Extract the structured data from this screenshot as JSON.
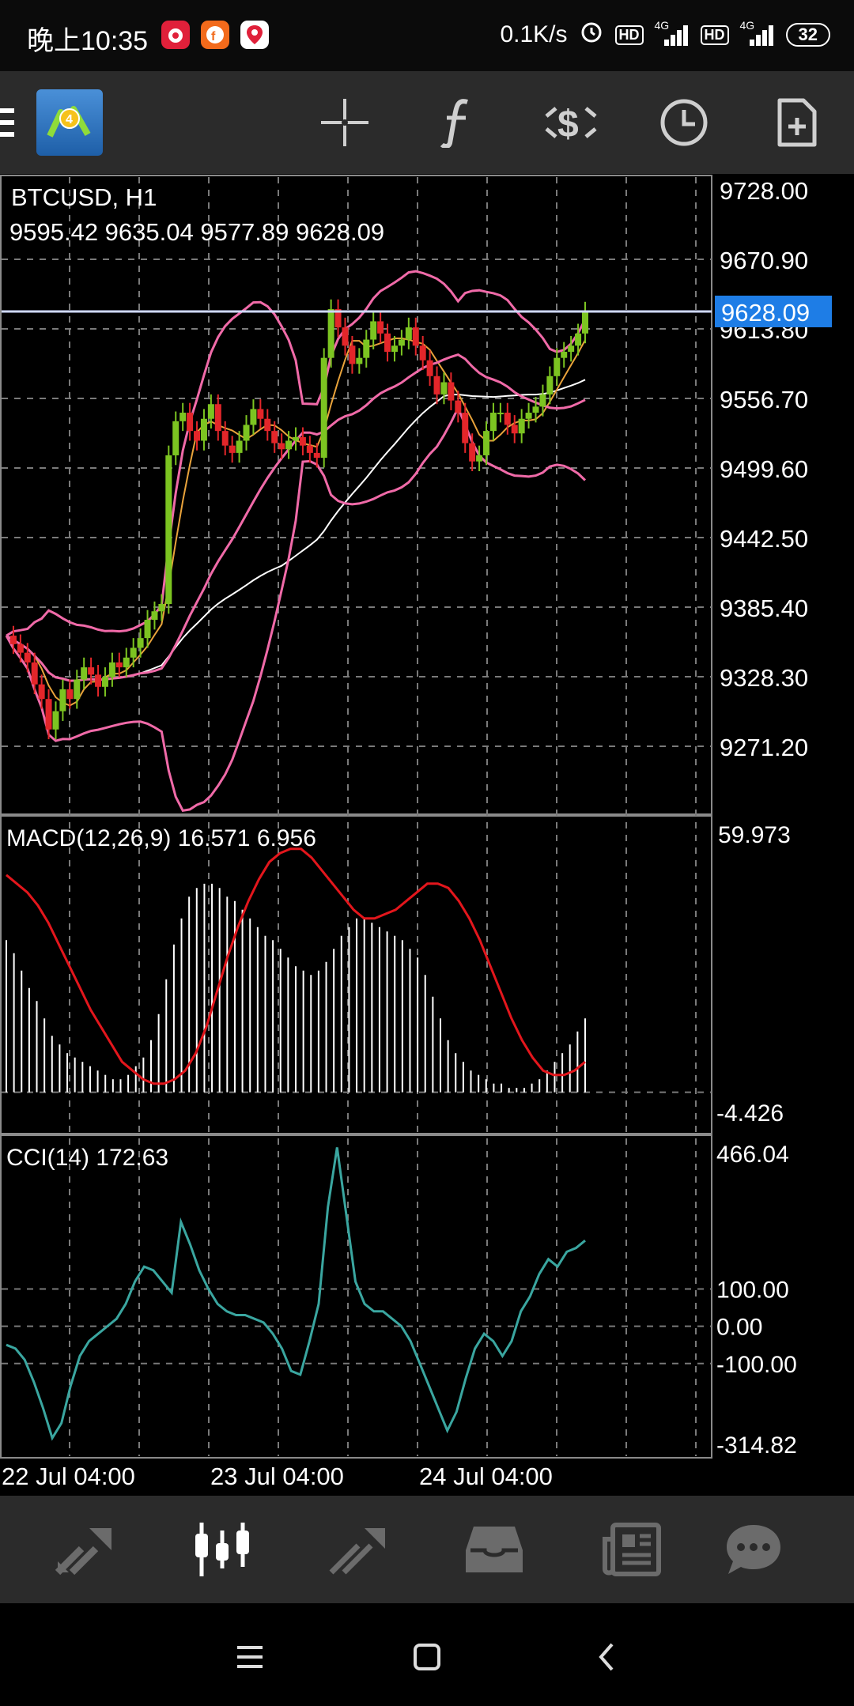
{
  "status_bar": {
    "time": "晚上10:35",
    "net_speed": "0.1K/s",
    "hd1": "HD",
    "net1": "4G",
    "hd2": "HD",
    "net2": "4G",
    "battery": "32",
    "app_icons": [
      "weibo-icon",
      "f-app-icon",
      "map-pin-app-icon"
    ]
  },
  "toolbar": {
    "icons": [
      "menu-icon",
      "metatrader4-logo",
      "crosshair-icon",
      "indicators-icon",
      "trade-icon",
      "timeframe-clock-icon",
      "new-order-icon"
    ]
  },
  "chart": {
    "symbol_label": "BTCUSD, H1",
    "ohlc_label": "9595.42 9635.04 9577.89 9628.09",
    "current_price": "9628.09",
    "price_axis": [
      "9728.00",
      "9670.90",
      "9613.80",
      "9556.70",
      "9499.60",
      "9442.50",
      "9385.40",
      "9328.30",
      "9271.20"
    ],
    "macd_label": "MACD(12,26,9) 16.571 6.956",
    "macd_axis": [
      "59.973",
      "-4.426"
    ],
    "cci_label": "CCI(14) 172.63",
    "cci_axis": [
      "466.04",
      "100.00",
      "0.00",
      "-100.00",
      "-314.82"
    ],
    "time_axis": [
      "22 Jul 04:00",
      "23 Jul 04:00",
      "24 Jul 04:00"
    ],
    "colors": {
      "bull": "#7cc421",
      "bear": "#e3262a",
      "bands": "#f06aa8",
      "ma_fast": "#e9a33b",
      "ma_slow": "#ffffff",
      "macd_signal": "#e3161c",
      "cci": "#3aa6a0",
      "bid_line": "#cfd9ff",
      "price_tag": "#1e7de6"
    }
  },
  "chart_data": {
    "type": "line",
    "title": "BTCUSD, H1",
    "last_ohlc": {
      "open": 9595.42,
      "high": 9635.04,
      "low": 9577.89,
      "close": 9628.09
    },
    "ylim": [
      9242.65,
      9728.0
    ],
    "x_ticks": [
      "22 Jul 04:00",
      "23 Jul 04:00",
      "24 Jul 04:00"
    ],
    "close": [
      9362,
      9355,
      9348,
      9340,
      9322,
      9310,
      9285,
      9300,
      9318,
      9310,
      9326,
      9336,
      9330,
      9320,
      9328,
      9340,
      9336,
      9344,
      9352,
      9360,
      9375,
      9382,
      9388,
      9510,
      9538,
      9545,
      9530,
      9522,
      9540,
      9552,
      9530,
      9518,
      9512,
      9522,
      9535,
      9548,
      9540,
      9530,
      9520,
      9515,
      9522,
      9525,
      9518,
      9512,
      9508,
      9590,
      9630,
      9615,
      9600,
      9585,
      9590,
      9605,
      9620,
      9610,
      9595,
      9600,
      9605,
      9615,
      9600,
      9588,
      9575,
      9560,
      9570,
      9555,
      9545,
      9520,
      9505,
      9510,
      9530,
      9545,
      9545,
      9535,
      9528,
      9540,
      9545,
      9550,
      9560,
      9575,
      9590,
      9595,
      9600,
      9610,
      9628
    ],
    "macd_histogram": [
      35,
      32,
      28,
      24,
      21,
      17,
      13,
      11,
      9,
      8,
      7,
      6,
      5,
      4,
      3,
      3,
      4,
      6,
      8,
      12,
      18,
      26,
      34,
      40,
      45,
      47,
      48,
      48,
      47,
      45,
      44,
      42,
      40,
      38,
      36,
      35,
      33,
      31,
      29,
      28,
      27,
      28,
      30,
      33,
      36,
      38,
      40,
      40,
      39,
      38,
      37,
      36,
      35,
      33,
      31,
      27,
      22,
      17,
      12,
      9,
      7,
      5,
      4,
      3,
      2,
      2,
      1,
      1,
      1,
      2,
      3,
      5,
      7,
      9,
      11,
      14,
      17
    ],
    "macd_signal": [
      50,
      48,
      46,
      43,
      39,
      34,
      29,
      24,
      19,
      15,
      11,
      7,
      5,
      3,
      2,
      2,
      3,
      5,
      9,
      15,
      23,
      31,
      38,
      44,
      49,
      53,
      55,
      56,
      56,
      54,
      51,
      48,
      45,
      42,
      40,
      40,
      41,
      42,
      44,
      46,
      48,
      48,
      47,
      44,
      40,
      35,
      29,
      23,
      17,
      12,
      8,
      5,
      4,
      4,
      5,
      7
    ],
    "cci": [
      -50,
      -60,
      -90,
      -150,
      -220,
      -300,
      -260,
      -160,
      -80,
      -40,
      -20,
      0,
      20,
      60,
      120,
      160,
      150,
      120,
      90,
      280,
      220,
      150,
      100,
      60,
      40,
      30,
      30,
      20,
      10,
      -20,
      -60,
      -120,
      -130,
      -40,
      60,
      320,
      480,
      300,
      120,
      60,
      40,
      40,
      20,
      0,
      -40,
      -100,
      -160,
      -220,
      -280,
      -230,
      -140,
      -60,
      -20,
      -40,
      -80,
      -40,
      40,
      80,
      140,
      180,
      160,
      200,
      210,
      230
    ]
  },
  "bottom_nav": {
    "items": [
      "quotes-icon",
      "chart-icon",
      "trade-icon",
      "history-icon",
      "news-icon",
      "messages-icon"
    ],
    "active": 1
  },
  "system_nav": {
    "items": [
      "recents-icon",
      "home-icon",
      "back-icon"
    ]
  }
}
